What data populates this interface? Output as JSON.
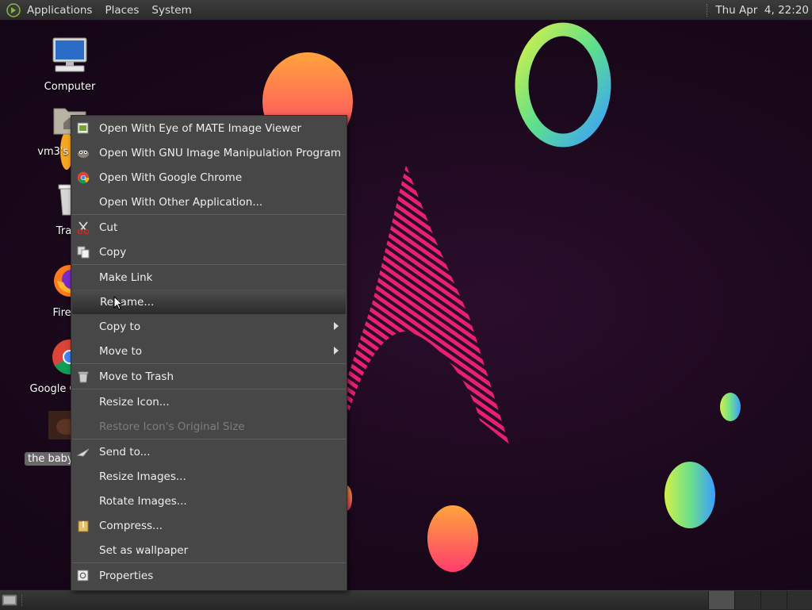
{
  "top_panel": {
    "menus": [
      "Applications",
      "Places",
      "System"
    ],
    "clock": "Thu Apr  4, 22:20"
  },
  "desktop": {
    "icons": [
      {
        "label": "Computer",
        "icon": "computer-icon"
      },
      {
        "label": "vm3's Home",
        "icon": "home-folder-icon"
      },
      {
        "label": "Trash",
        "icon": "trash-icon"
      },
      {
        "label": "Firefox",
        "icon": "firefox-icon"
      },
      {
        "label": "Google Chrome",
        "icon": "chrome-icon"
      },
      {
        "label": "the baby",
        "icon": "image-file-icon",
        "selected": true
      }
    ]
  },
  "context_menu": {
    "items": [
      {
        "label": "Open With Eye of MATE Image Viewer",
        "icon": "eom-icon"
      },
      {
        "label": "Open With GNU Image Manipulation Program",
        "icon": "gimp-icon"
      },
      {
        "label": "Open With Google Chrome",
        "icon": "chrome-icon"
      },
      {
        "label": "Open With Other Application...",
        "icon": ""
      },
      {
        "label": "Cut",
        "icon": "scissors-icon"
      },
      {
        "label": "Copy",
        "icon": "copy-icon"
      },
      {
        "label": "Make Link",
        "icon": ""
      },
      {
        "label": "Rename...",
        "icon": "",
        "hover": true
      },
      {
        "label": "Copy to",
        "icon": "",
        "submenu": true
      },
      {
        "label": "Move to",
        "icon": "",
        "submenu": true
      },
      {
        "label": "Move to Trash",
        "icon": "trash-icon"
      },
      {
        "label": "Resize Icon...",
        "icon": ""
      },
      {
        "label": "Restore Icon's Original Size",
        "icon": "",
        "disabled": true
      },
      {
        "label": "Send to...",
        "icon": "send-icon"
      },
      {
        "label": "Resize Images...",
        "icon": ""
      },
      {
        "label": "Rotate Images...",
        "icon": ""
      },
      {
        "label": "Compress...",
        "icon": "archive-icon"
      },
      {
        "label": "Set as wallpaper",
        "icon": ""
      },
      {
        "label": "Properties",
        "icon": "properties-icon"
      }
    ]
  },
  "colors": {
    "menu_bg": "#474747",
    "panel_bg": "#2b2b2b",
    "wallpaper_bg": "#1a081b",
    "accent_pink": "#e8206f"
  }
}
